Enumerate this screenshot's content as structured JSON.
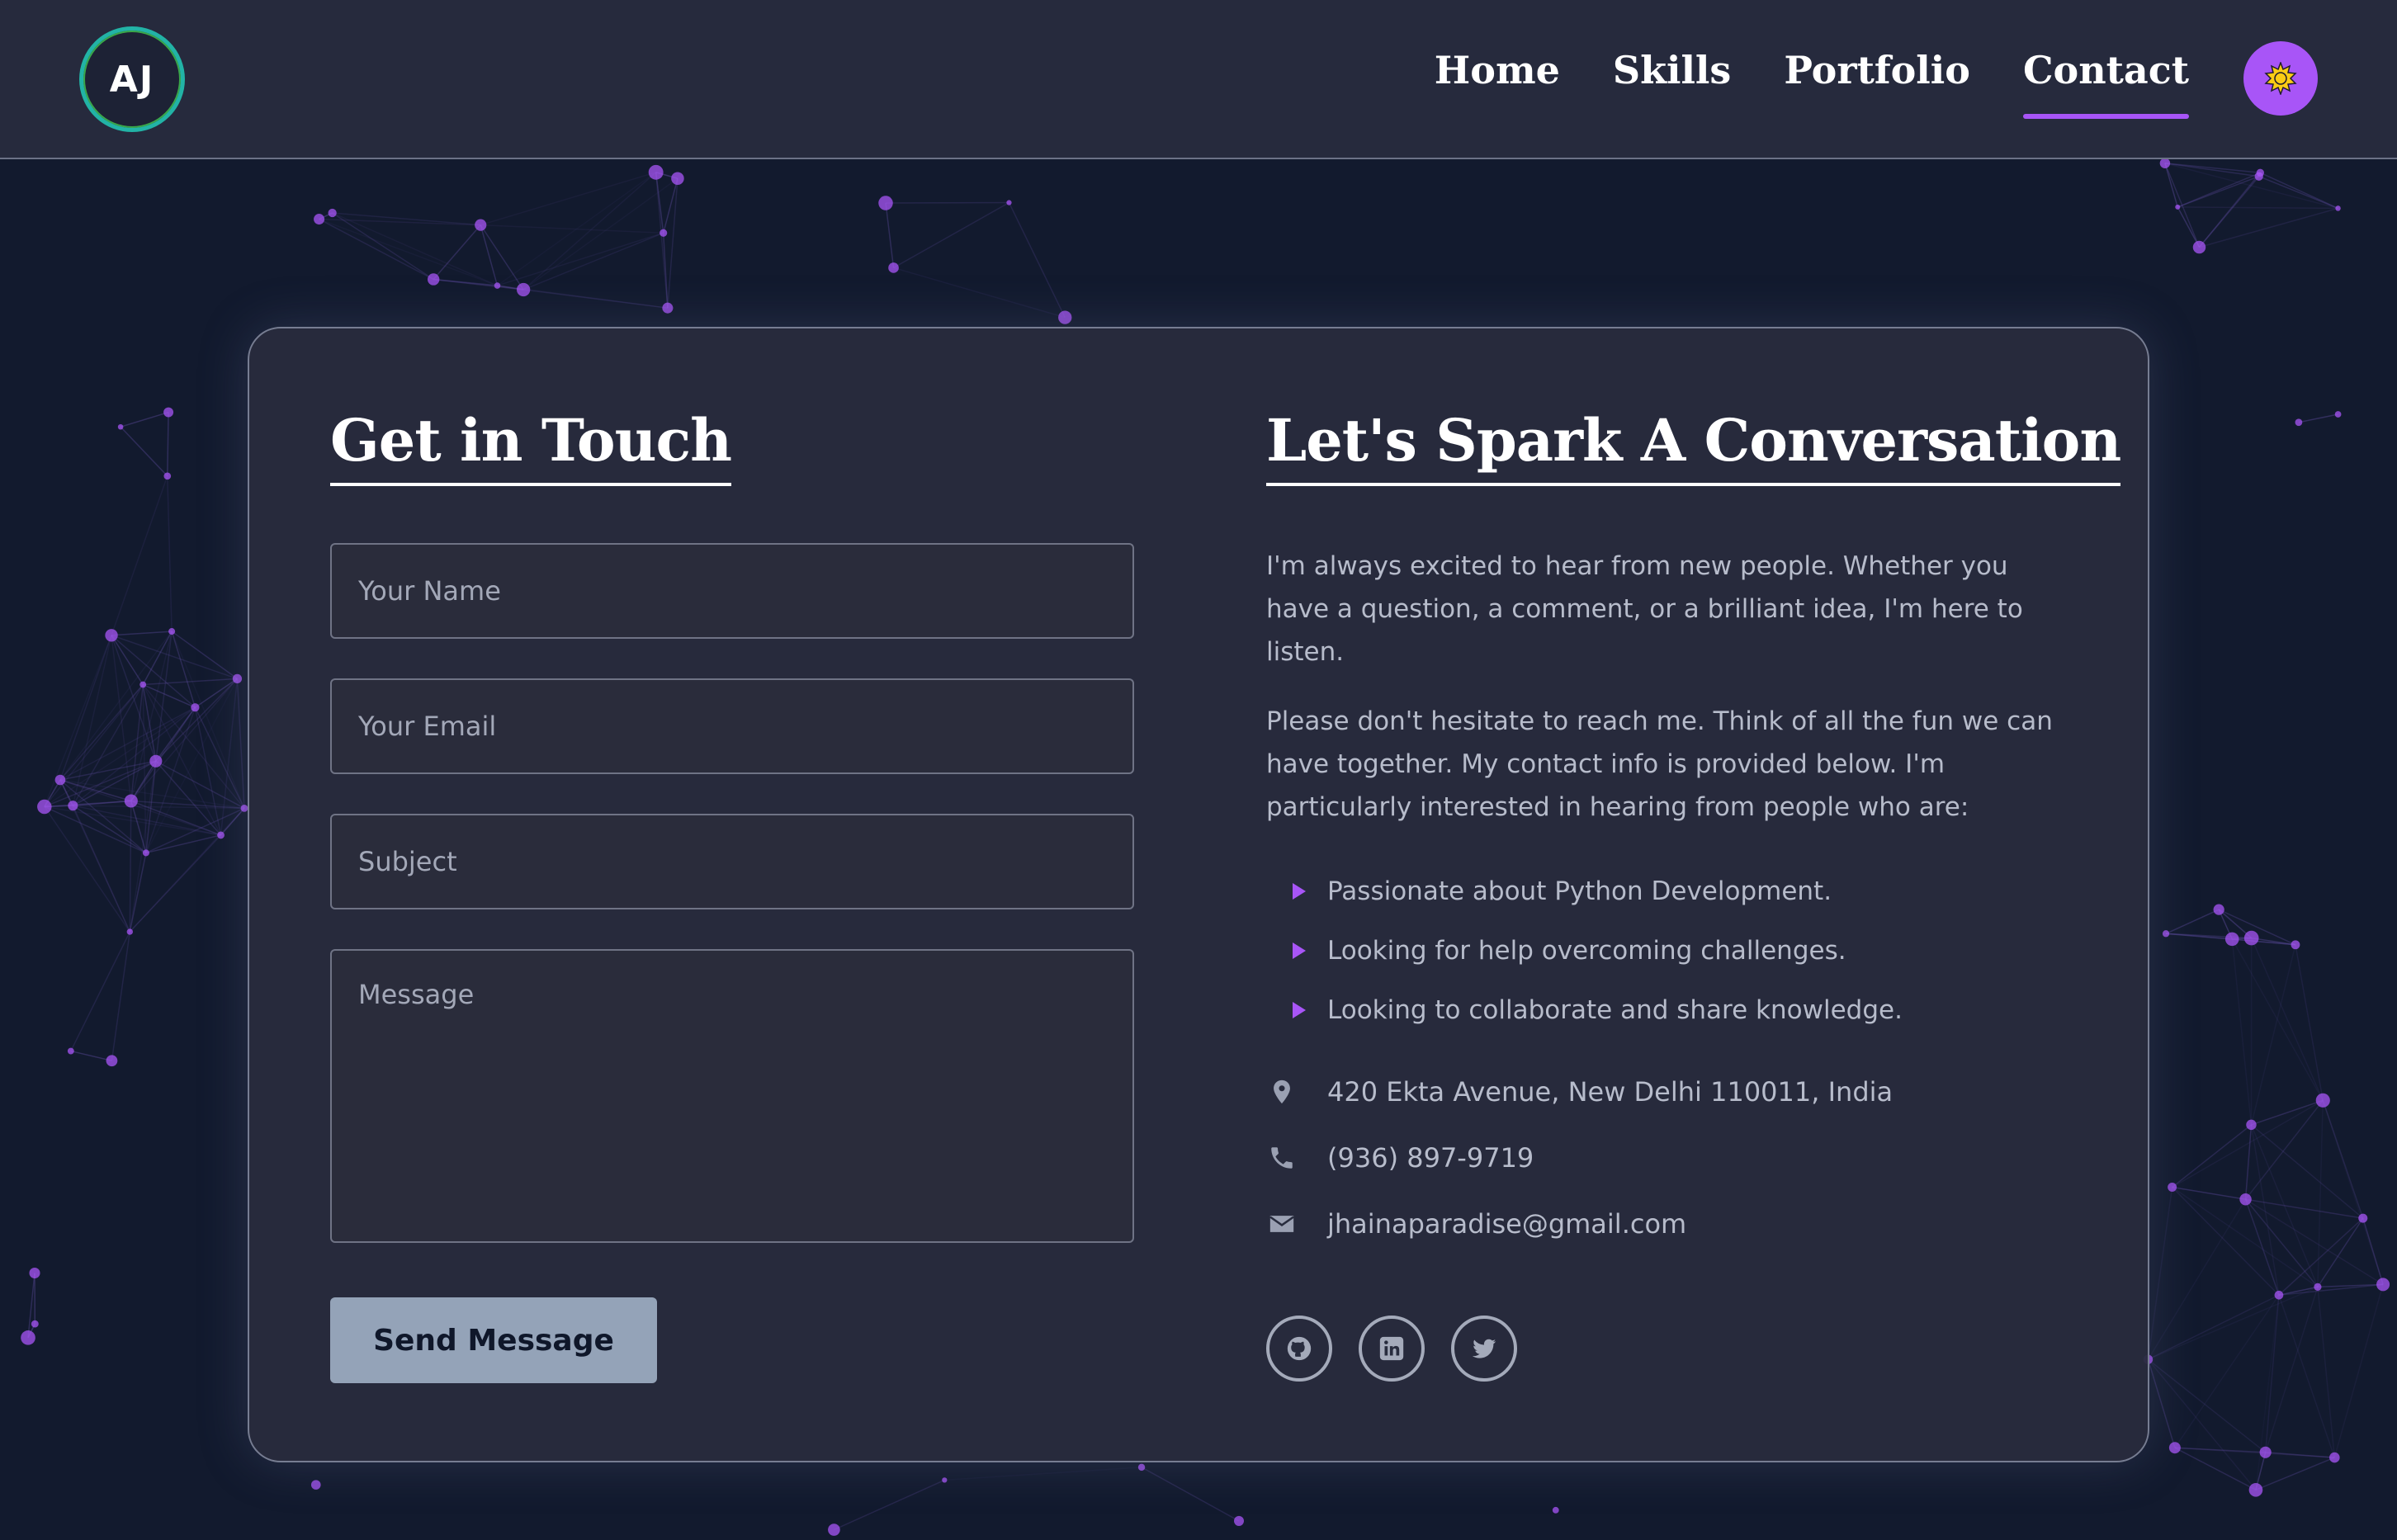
{
  "brand": {
    "logo_text": "AJ"
  },
  "nav": {
    "items": [
      {
        "label": "Home"
      },
      {
        "label": "Skills"
      },
      {
        "label": "Portfolio"
      },
      {
        "label": "Contact"
      }
    ],
    "active": "Contact"
  },
  "theme_toggle": {
    "icon": "sun-icon",
    "color": "#a855f7"
  },
  "form": {
    "heading": "Get in Touch",
    "name_placeholder": "Your Name",
    "email_placeholder": "Your Email",
    "subject_placeholder": "Subject",
    "message_placeholder": "Message",
    "submit_label": "Send Message"
  },
  "info": {
    "heading": "Let's Spark A Conversation",
    "paragraph1": "I'm always excited to hear from new people. Whether you have a question, a comment, or a brilliant idea, I'm here to listen.",
    "paragraph2": "Please don't hesitate to reach me. Think of all the fun we can have together. My contact info is provided below. I'm particularly interested in hearing from people who are:",
    "bullets": [
      "Passionate about Python Development.",
      "Looking for help overcoming challenges.",
      "Looking to collaborate and share knowledge."
    ],
    "address": "420 Ekta Avenue, New Delhi 110011, India",
    "phone": "(936) 897-9719",
    "email": "jhainaparadise@gmail.com",
    "socials": [
      "github-icon",
      "linkedin-icon",
      "twitter-icon"
    ]
  },
  "colors": {
    "accent": "#a855f7",
    "background": "#121a2e",
    "card": "#282c3e",
    "button": "#94a3b8"
  }
}
